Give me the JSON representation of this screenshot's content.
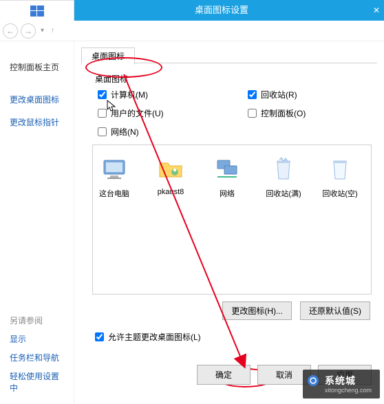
{
  "titlebar": {
    "title": "桌面图标设置"
  },
  "sidebar": {
    "home": "控制面板主页",
    "link1": "更改桌面图标",
    "link2": "更改鼠标指针",
    "seealso": "另请参阅",
    "s1": "显示",
    "s2": "任务栏和导航",
    "s3": "轻松使用设置中"
  },
  "dialog": {
    "tab": "桌面图标",
    "group": "桌面图标",
    "cb_computer": "计算机(M)",
    "cb_recycle": "回收站(R)",
    "cb_userfiles": "用户的文件(U)",
    "cb_cpanel": "控制面板(O)",
    "cb_network": "网络(N)",
    "icons": {
      "pc": "这台电脑",
      "user": "pkaust8",
      "net": "网络",
      "bin_full": "回收站(满)",
      "bin_empty": "回收站(空)"
    },
    "btn_change": "更改图标(H)...",
    "btn_restore": "还原默认值(S)",
    "allow_theme": "允许主题更改桌面图标(L)",
    "ok": "确定",
    "cancel": "取消",
    "apply": "应用"
  },
  "watermark": {
    "t1": "系统城",
    "t2": "xitongcheng.com"
  }
}
